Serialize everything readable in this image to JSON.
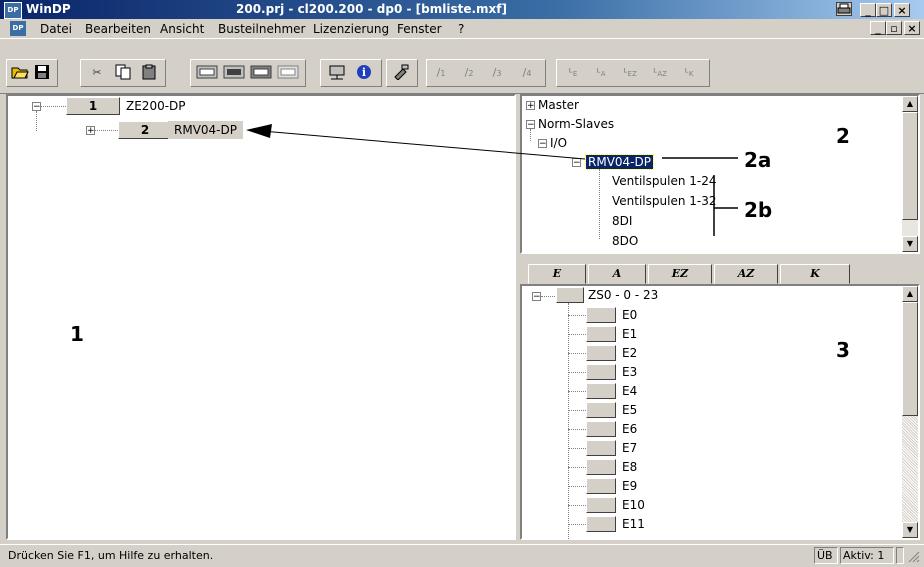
{
  "window": {
    "app_icon_text": "DP",
    "app_name": "WinDP",
    "caption": "200.prj - cl200.200 - dp0 - [bmliste.mxf]"
  },
  "menubar": {
    "items": [
      "Datei",
      "Bearbeiten",
      "Ansicht",
      "Busteilnehmer",
      "Lizenzierung",
      "Fenster",
      "?"
    ]
  },
  "toolbar": {
    "buttons": [
      "open-icon",
      "save-icon",
      "cut-icon",
      "copy-icon",
      "paste-icon",
      "io-module-icon",
      "io-module-2-icon",
      "io-module-3-icon",
      "io-module-4-icon",
      "network-icon",
      "info-icon",
      "tool-icon",
      "slot-1",
      "slot-2",
      "slot-3",
      "slot-4",
      "type-e",
      "type-a",
      "type-ez",
      "type-az",
      "type-k"
    ],
    "labels": {
      "slot_1": "1",
      "slot_2": "2",
      "slot_3": "3",
      "slot_4": "4",
      "type_e": "E",
      "type_a": "A",
      "type_ez": "EZ",
      "type_az": "AZ",
      "type_k": "K"
    }
  },
  "left_panel": {
    "nodes": [
      {
        "number": "1",
        "label": "ZE200-DP"
      },
      {
        "number": "2",
        "label": "RMV04-DP"
      }
    ],
    "callout": "1"
  },
  "right_top_panel": {
    "tree": {
      "master": "Master",
      "norm_slaves": "Norm-Slaves",
      "io": "I/O",
      "selected": "RMV04-DP",
      "children": [
        "Ventilspulen 1-24",
        "Ventilspulen 1-32",
        "8DI",
        "8DO"
      ]
    },
    "callouts": {
      "panel": "2",
      "selected": "2a",
      "children": "2b"
    }
  },
  "right_bottom_panel": {
    "tabs": [
      "E",
      "A",
      "EZ",
      "AZ",
      "K"
    ],
    "group_label": "ZS0 - 0 - 23",
    "rows": [
      "E0",
      "E1",
      "E2",
      "E3",
      "E4",
      "E5",
      "E6",
      "E7",
      "E8",
      "E9",
      "E10",
      "E11"
    ],
    "callout": "3"
  },
  "statusbar": {
    "message": "Drücken Sie F1, um Hilfe zu erhalten.",
    "ub": "ÜB",
    "active": "Aktiv: 1"
  },
  "colors": {
    "face": "#d4d0c8",
    "titlebar_start": "#0a246a",
    "selection": "#0a246a",
    "info_blue": "#1f3fbf"
  }
}
